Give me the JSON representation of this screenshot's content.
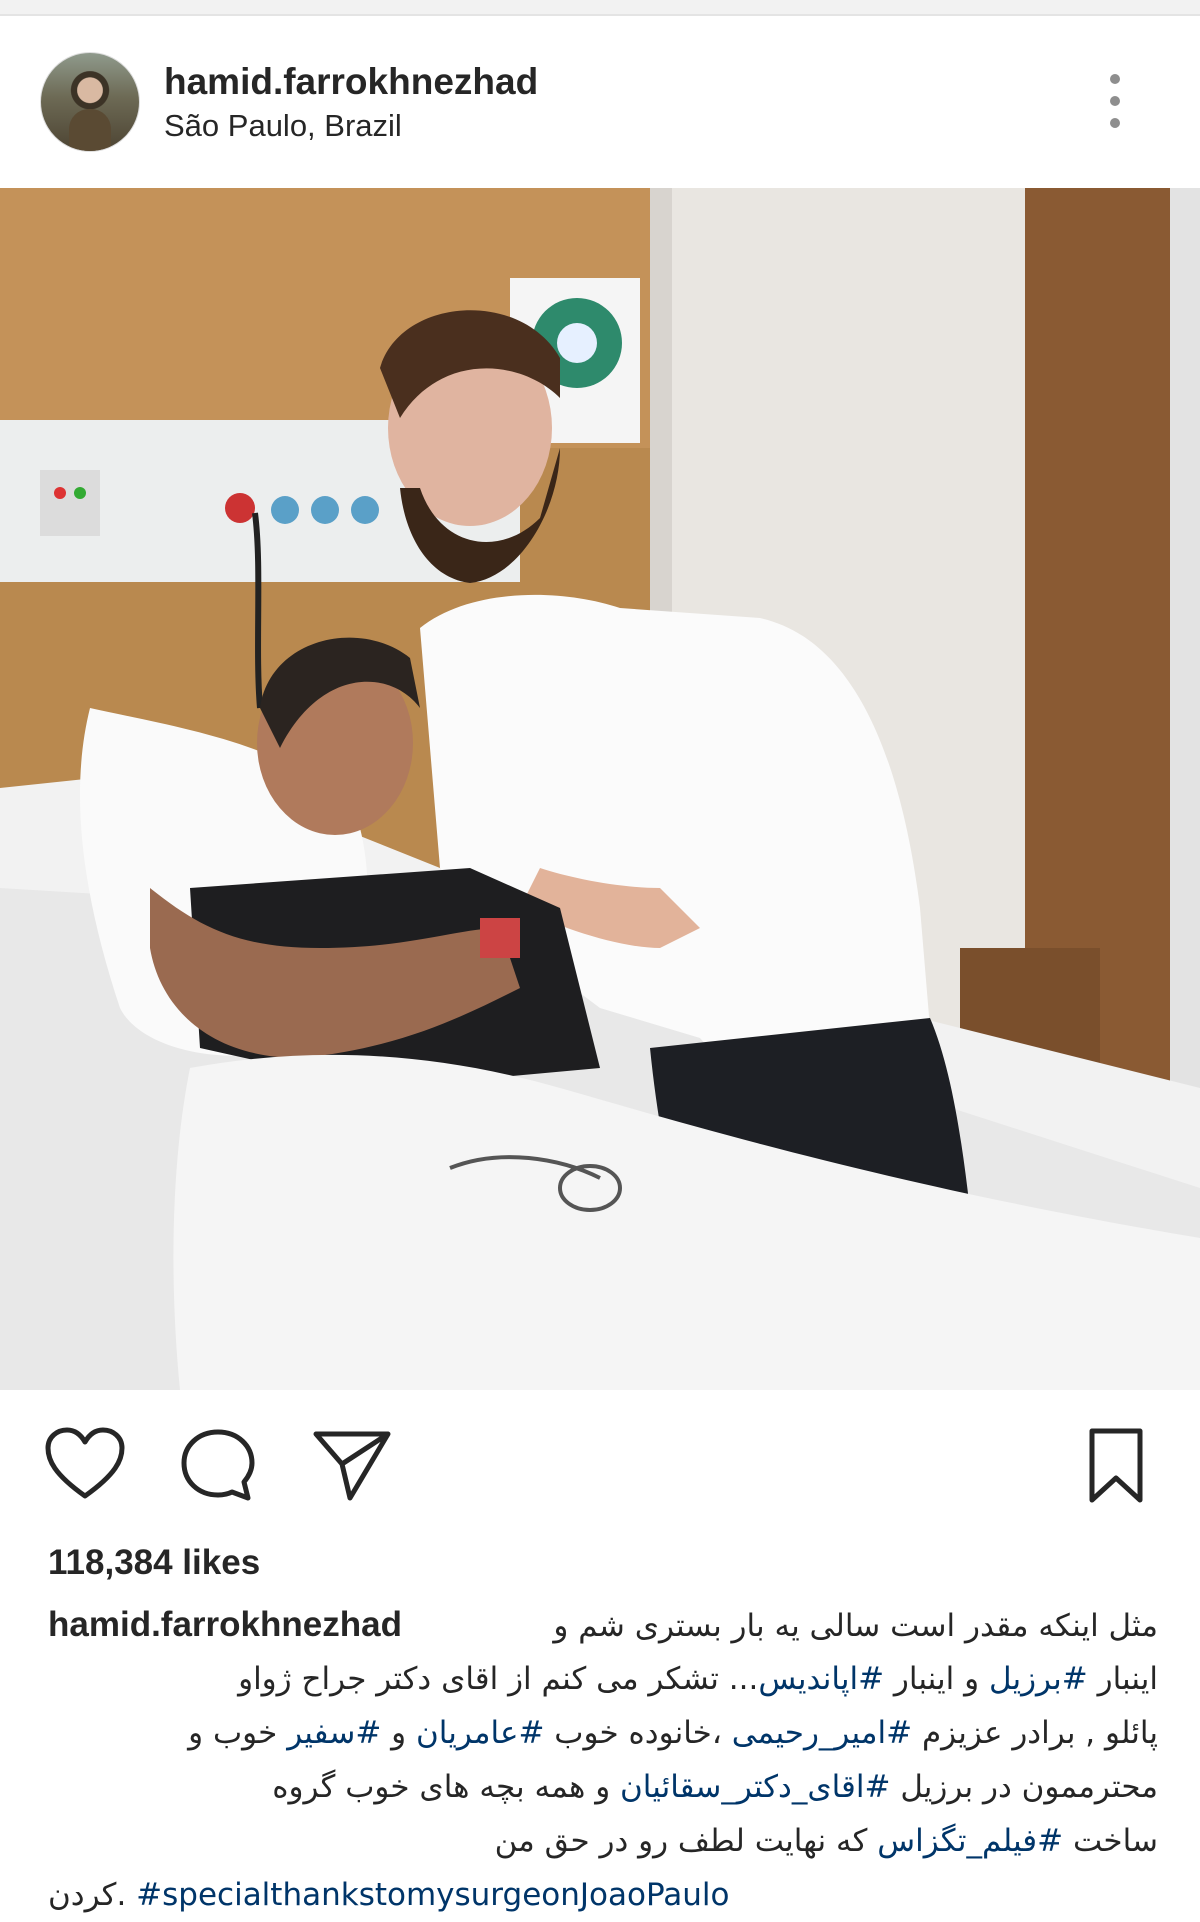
{
  "post": {
    "username": "hamid.farrokhnezhad",
    "location": "São Paulo, Brazil",
    "likes": "118,384 likes"
  },
  "icons": {
    "more": "more-options-icon",
    "like": "heart-icon",
    "comment": "comment-icon",
    "share": "send-icon",
    "save": "bookmark-icon"
  },
  "caption": {
    "username": "hamid.farrokhnezhad",
    "line1_text": "مثل اینکه مقدر است سالی یه بار بستری شم و",
    "line2_pre": "اینبار ",
    "line2_tag1": "#برزیل",
    "line2_mid": " و اینبار ",
    "line2_tag2": "#اپاندیس",
    "line2_post": "... تشکر می کنم از اقای دکتر جراح ژواو",
    "line3_pre": "پائلو , برادر عزیزم ",
    "line3_tag1": "#امیر_رحیمی",
    "line3_mid": " ،خانوده خوب ",
    "line3_tag2": "#عامریان",
    "line3_mid2": " و ",
    "line3_tag3": "#سفیر",
    "line3_post": " خوب و",
    "line4_pre": "محترممون در برزیل ",
    "line4_tag": "#اقای_دکتر_سقائیان",
    "line4_post": " و همه بچه های خوب گروه",
    "line5_pre": "ساخت ",
    "line5_tag": "#فیلم_تگزاس",
    "line5_post": " که نهایت لطف رو در حق من",
    "line6_pre": "کردن. ",
    "line6_tag": "#specialthankstomysurgeonJoaoPaulo"
  },
  "colors": {
    "text": "#262626",
    "hashtag": "#003569",
    "secondary": "#8e8e8e"
  }
}
